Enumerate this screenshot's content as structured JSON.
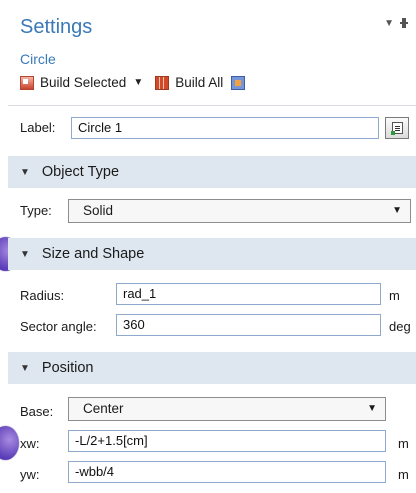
{
  "header": {
    "title": "Settings",
    "subtitle": "Circle"
  },
  "toolbar": {
    "build_selected_label": "Build Selected",
    "build_all_label": "Build All"
  },
  "label_row": {
    "label": "Label:",
    "value": "Circle 1"
  },
  "sections": {
    "object_type": "Object Type",
    "size_and_shape": "Size and Shape",
    "position": "Position"
  },
  "object_type": {
    "type_label": "Type:",
    "type_value": "Solid"
  },
  "size_shape": {
    "radius_label": "Radius:",
    "radius_value": "rad_1",
    "radius_unit": "m",
    "sector_label": "Sector angle:",
    "sector_value": "360",
    "sector_unit": "deg"
  },
  "position": {
    "base_label": "Base:",
    "base_value": "Center",
    "xw_label": "xw:",
    "xw_value": "-L/2+1.5[cm]",
    "xw_unit": "m",
    "yw_label": "yw:",
    "yw_value": "-wbb/4",
    "yw_unit": "m"
  }
}
